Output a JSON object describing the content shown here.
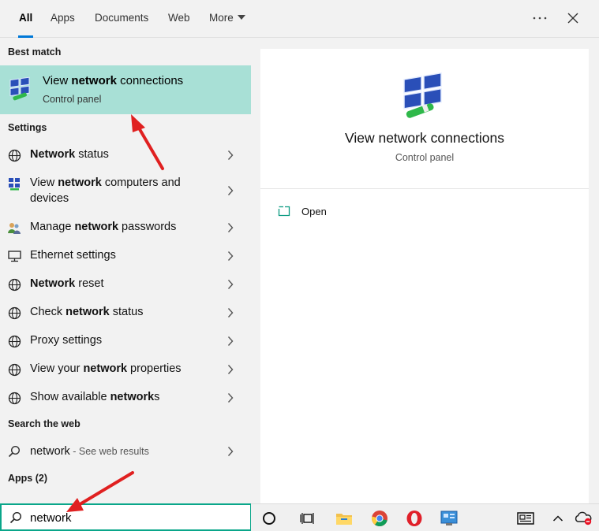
{
  "tabs": [
    {
      "label": "All",
      "active": true
    },
    {
      "label": "Apps"
    },
    {
      "label": "Documents"
    },
    {
      "label": "Web"
    },
    {
      "label": "More"
    }
  ],
  "header_icons": {
    "options": "more-options-icon",
    "close": "close-icon"
  },
  "best_match": {
    "heading": "Best match",
    "title_pre": "View ",
    "title_bold": "network",
    "title_post": " connections",
    "subtitle": "Control panel",
    "icon": "network-connections-icon",
    "highlight_color": "#a8e0d6"
  },
  "settings": {
    "heading": "Settings",
    "items": [
      {
        "pre": "",
        "bold": "Network",
        "post": " status",
        "icon": "globe-icon"
      },
      {
        "pre": "View ",
        "bold": "network",
        "post": " computers and",
        "line2": "devices",
        "icon": "network-computers-icon"
      },
      {
        "pre": "Manage ",
        "bold": "network",
        "post": " passwords",
        "icon": "credential-manager-icon"
      },
      {
        "pre": "Ethernet settings",
        "bold": "",
        "post": "",
        "icon": "ethernet-icon"
      },
      {
        "pre": "",
        "bold": "Network",
        "post": " reset",
        "icon": "globe-icon"
      },
      {
        "pre": "Check ",
        "bold": "network",
        "post": " status",
        "icon": "globe-icon"
      },
      {
        "pre": "Proxy settings",
        "bold": "",
        "post": "",
        "icon": "globe-icon"
      },
      {
        "pre": "View your ",
        "bold": "network",
        "post": " properties",
        "icon": "globe-icon"
      },
      {
        "pre": "Show available ",
        "bold": "network",
        "post": "s",
        "icon": "globe-icon"
      }
    ]
  },
  "web": {
    "heading": "Search the web",
    "query": "network",
    "suffix": " - See web results",
    "icon": "search-icon"
  },
  "apps": {
    "heading": "Apps (2)"
  },
  "preview": {
    "title": "View network connections",
    "subtitle": "Control panel",
    "open_label": "Open",
    "icon": "network-connections-icon"
  },
  "search": {
    "value": "network",
    "icon": "search-icon"
  },
  "taskbar": [
    {
      "name": "cortana-icon"
    },
    {
      "name": "task-view-icon"
    },
    {
      "name": "file-explorer-icon"
    },
    {
      "name": "chrome-icon"
    },
    {
      "name": "opera-icon"
    },
    {
      "name": "control-panel-icon"
    },
    {
      "name": "news-icon"
    },
    {
      "name": "chevron-up-icon"
    },
    {
      "name": "onedrive-icon"
    }
  ],
  "accent": "#0078d7",
  "search_border": "#0aa68a",
  "annotation_color": "#e02020"
}
